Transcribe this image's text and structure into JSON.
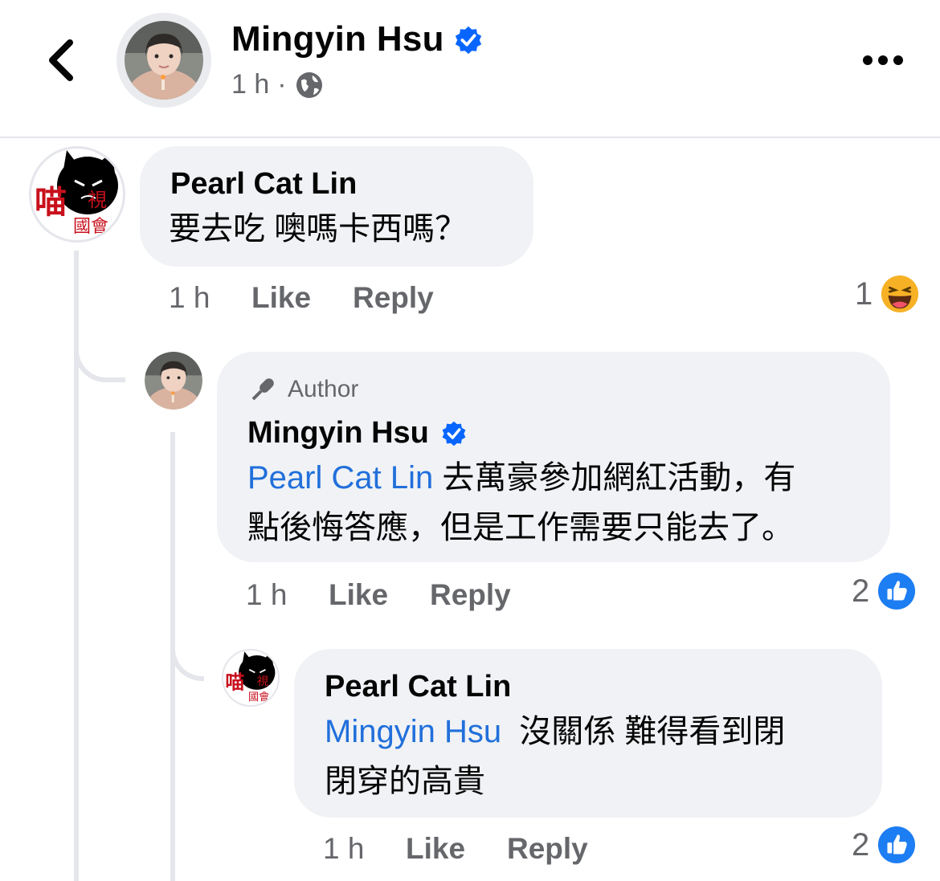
{
  "header": {
    "title": "Mingyin Hsu",
    "time": "1 h",
    "separator": "·",
    "privacy_icon": "globe-icon",
    "back_icon": "chevron-left-icon",
    "more_icon": "more-horizontal-icon"
  },
  "comments": [
    {
      "author": "Pearl Cat Lin",
      "text": "要去吃  噢嗎卡西嗎？",
      "time": "1 h",
      "like_label": "Like",
      "reply_label": "Reply",
      "reaction_count": "1",
      "reaction_type": "haha-emoji-icon"
    },
    {
      "badge": "Author",
      "author": "Mingyin Hsu",
      "mention": "Pearl Cat Lin",
      "text_line1": " 去萬豪參加網紅活動，有",
      "text_line2": "點後悔答應，但是工作需要只能去了。",
      "time": "1 h",
      "like_label": "Like",
      "reply_label": "Reply",
      "reaction_count": "2",
      "reaction_type": "like-icon"
    },
    {
      "author": "Pearl Cat Lin",
      "mention": "Mingyin Hsu",
      "text_line1": "  沒關係 難得看到閉",
      "text_line2": "閉穿的高貴",
      "time": "1 h",
      "like_label": "Like",
      "reply_label": "Reply",
      "reaction_count": "2",
      "reaction_type": "like-icon"
    }
  ],
  "avatar_art": {
    "text_top": "喵",
    "text_mid": "視",
    "text_bottom": "國會"
  },
  "colors": {
    "accent": "#0866ff",
    "mention": "#216fdb",
    "bubble": "#f0f2f5",
    "muted": "#65676b"
  }
}
